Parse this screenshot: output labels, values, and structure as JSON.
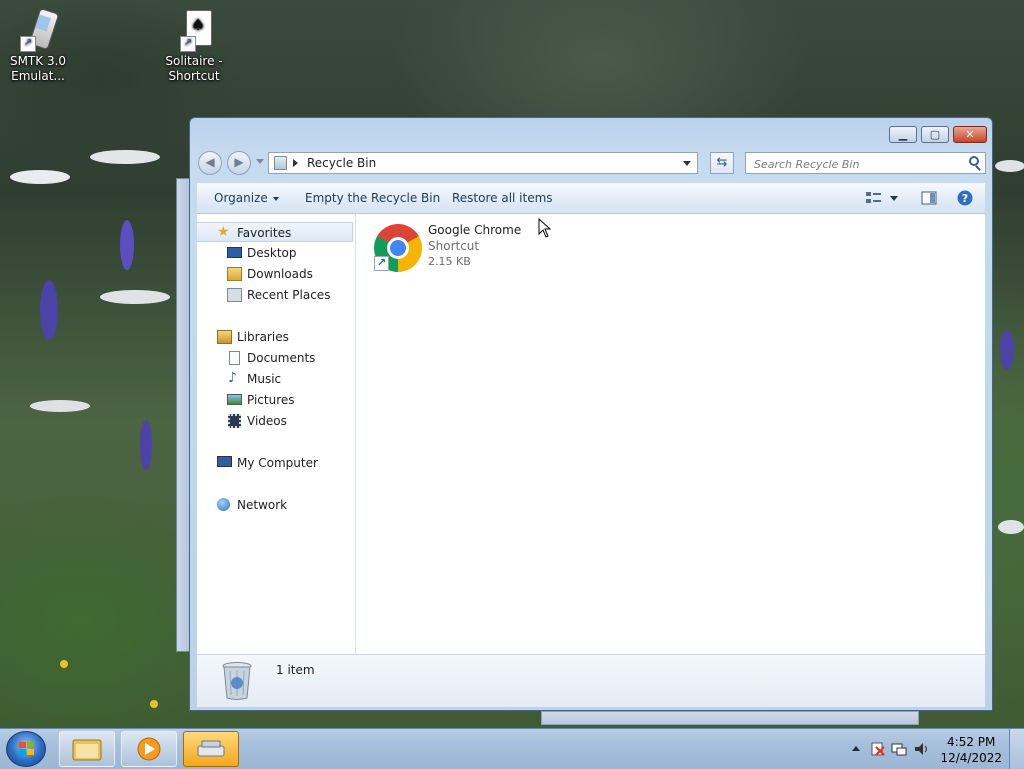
{
  "desktop": {
    "icons": [
      {
        "label_line1": "SMTK 3.0",
        "label_line2": "Emulat..."
      },
      {
        "label_line1": "Solitaire -",
        "label_line2": "Shortcut"
      }
    ]
  },
  "window": {
    "address": {
      "location": "Recycle Bin"
    },
    "search": {
      "placeholder": "Search Recycle Bin"
    },
    "toolbar": {
      "organize_label": "Organize",
      "empty_label": "Empty the Recycle Bin",
      "restore_label": "Restore all items"
    },
    "nav": {
      "favorites": "Favorites",
      "desktop": "Desktop",
      "downloads": "Downloads",
      "recent_places": "Recent Places",
      "libraries": "Libraries",
      "documents": "Documents",
      "music": "Music",
      "pictures": "Pictures",
      "videos": "Videos",
      "my_computer": "My Computer",
      "network": "Network"
    },
    "files": [
      {
        "name": "Google Chrome",
        "type": "Shortcut",
        "size": "2.15 KB"
      }
    ],
    "details": {
      "count": "1 item"
    }
  },
  "taskbar": {
    "time": "4:52 PM",
    "date": "12/4/2022"
  },
  "colors": {
    "accent": "#1e395b",
    "title_bar": "#b9d1ea",
    "close": "#c8452c"
  }
}
